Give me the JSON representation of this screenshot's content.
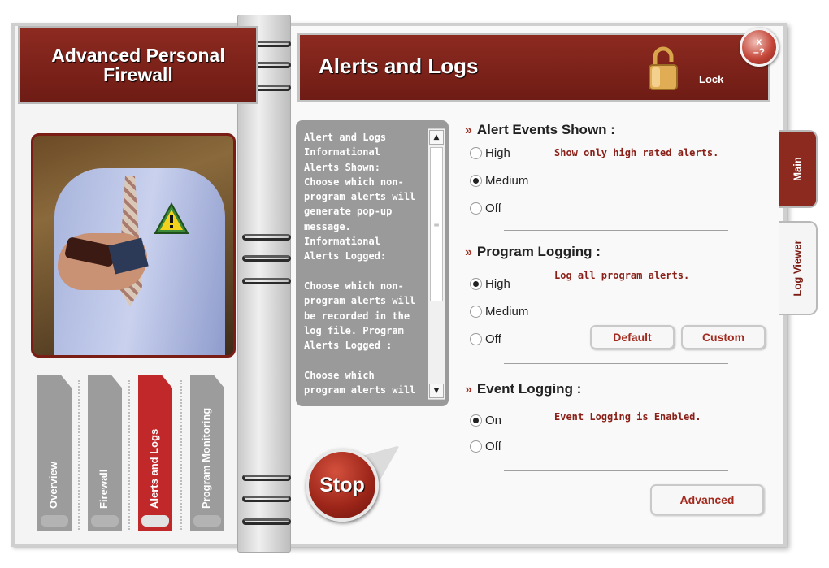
{
  "app": {
    "title": "Advanced Personal\nFirewall"
  },
  "nav_tabs": [
    {
      "label": "Overview",
      "active": false
    },
    {
      "label": "Firewall",
      "active": false
    },
    {
      "label": "Alerts and Logs",
      "active": true
    },
    {
      "label": "Program Monitoring",
      "active": false
    }
  ],
  "header": {
    "title": "Alerts and Logs",
    "lock_label": "Lock",
    "close_label": "x",
    "help_label": "?"
  },
  "side_tabs": {
    "main": "Main",
    "log_viewer": "Log Viewer"
  },
  "info_box": {
    "text": "Alert and Logs\nInformational\nAlerts Shown:\nChoose which non-\nprogram alerts will\ngenerate pop-up\nmessage.\nInformational\nAlerts Logged:\n\nChoose which non-\nprogram alerts will\nbe recorded in the\nlog file. Program\nAlerts Logged :\n\nChoose which\nprogram alerts will"
  },
  "stop_button": {
    "label": "Stop"
  },
  "alert_events": {
    "heading": "Alert Events Shown :",
    "options": [
      "High",
      "Medium",
      "Off"
    ],
    "selected": "Medium",
    "note": "Show only high rated alerts."
  },
  "program_logging": {
    "heading": "Program Logging  :",
    "options": [
      "High",
      "Medium",
      "Off"
    ],
    "selected": "High",
    "note": "Log all program alerts.",
    "default_label": "Default",
    "custom_label": "Custom"
  },
  "event_logging": {
    "heading": "Event Logging  :",
    "options": [
      "On",
      "Off"
    ],
    "selected": "On",
    "note": "Event Logging is Enabled."
  },
  "advanced_button": {
    "label": "Advanced"
  },
  "colors": {
    "brand_red": "#8d2a20",
    "accent_red": "#c0282a",
    "note_red": "#8a1f17",
    "info_gray": "#9a9a9a"
  },
  "icons": [
    "warning-icon",
    "lock-icon",
    "close-icon",
    "help-icon",
    "scroll-up-icon",
    "scroll-down-icon",
    "chevron-icon"
  ]
}
